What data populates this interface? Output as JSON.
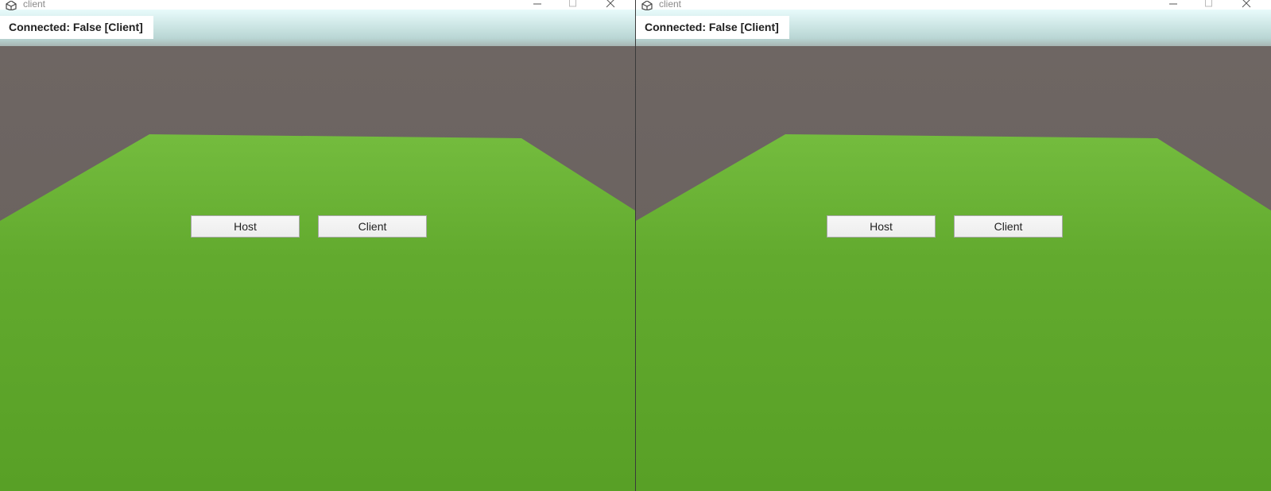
{
  "windows": [
    {
      "title": "client",
      "status_text": "Connected: False [Client]",
      "buttons": {
        "host_label": "Host",
        "client_label": "Client"
      }
    },
    {
      "title": "client",
      "status_text": "Connected: False [Client]",
      "buttons": {
        "host_label": "Host",
        "client_label": "Client"
      }
    }
  ],
  "icons": {
    "app": "unity-logo-icon",
    "minimize": "minimize-icon",
    "maximize": "maximize-icon",
    "close": "close-icon"
  },
  "colors": {
    "sky_top": "#e8fbfb",
    "wall": "#6a625f",
    "ground_far": "#74bc3e",
    "ground_near": "#58a026",
    "button_bg": "#f2f2f2",
    "button_border": "#a9a9a9"
  }
}
